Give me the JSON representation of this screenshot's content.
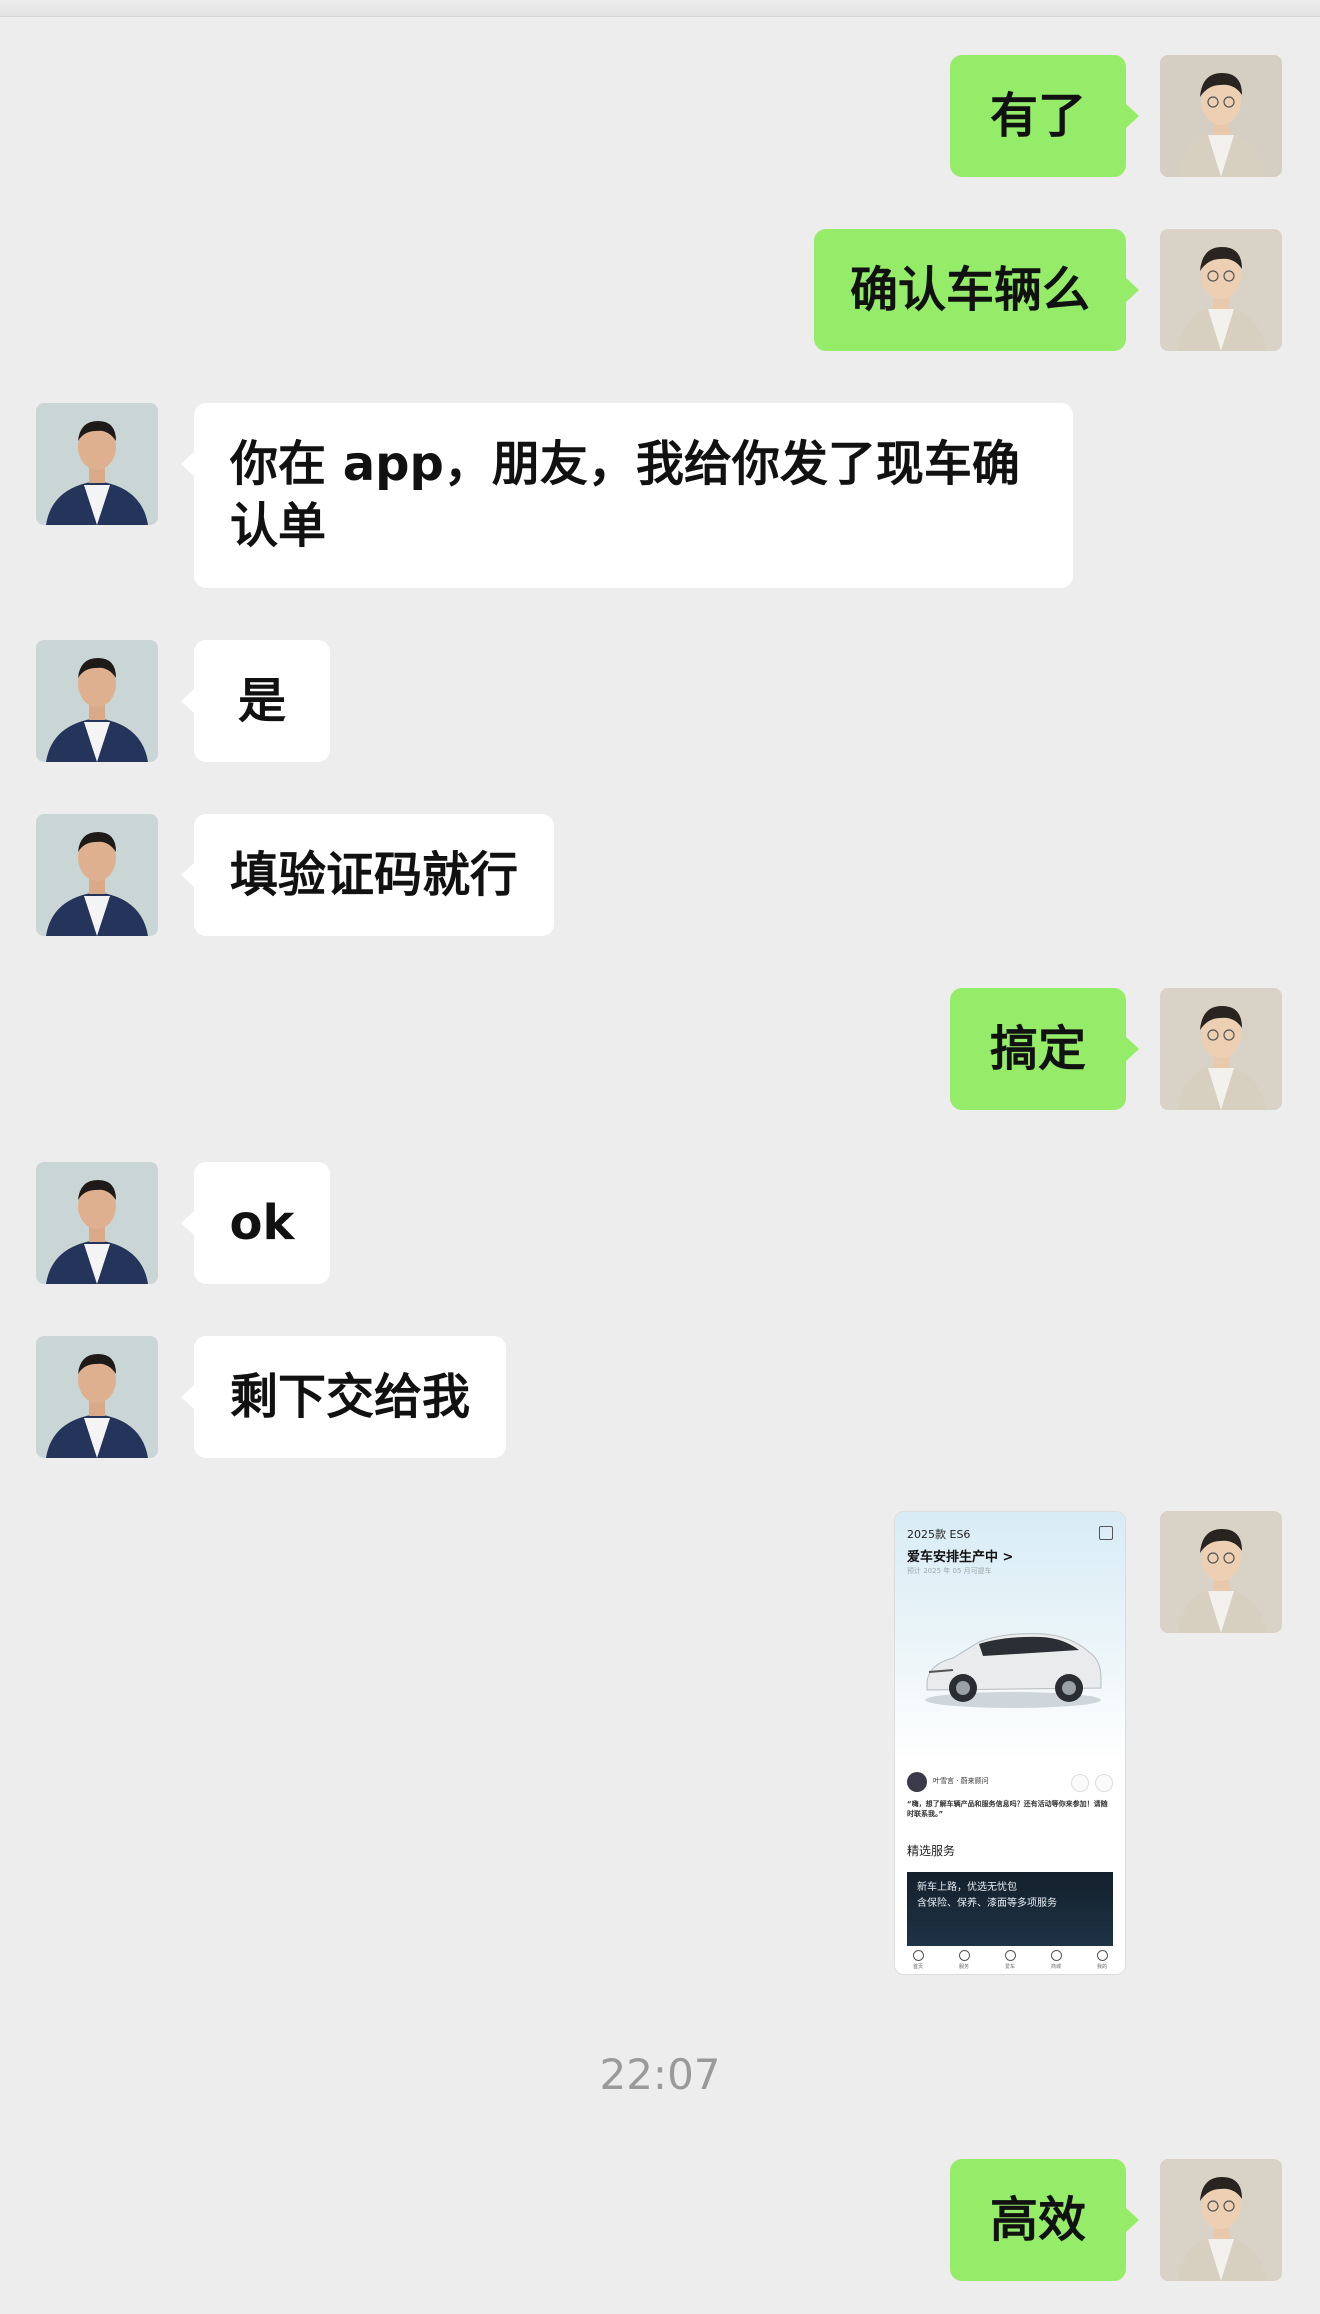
{
  "chat": {
    "messages": [
      {
        "sender": "me",
        "text": "有了"
      },
      {
        "sender": "me",
        "text": "确认车辆么"
      },
      {
        "sender": "other",
        "text": "你在 app，朋友，我给你发了现车确认单"
      },
      {
        "sender": "other",
        "text": "是"
      },
      {
        "sender": "other",
        "text": "填验证码就行"
      },
      {
        "sender": "me",
        "text": "搞定"
      },
      {
        "sender": "other",
        "text": "ok"
      },
      {
        "sender": "other",
        "text": "剩下交给我"
      },
      {
        "sender": "me",
        "type": "image",
        "description": "vehicle order status screenshot"
      },
      {
        "sender": "me",
        "text": "高效"
      }
    ],
    "timestamp": "22:07"
  },
  "shared_screenshot": {
    "model": "2025款 ES6",
    "status": "爱车安排生产中 >",
    "eta": "预计 2025 年 05 月可提车",
    "advisor_name": "叶雪言 · 蔚来顾问",
    "quote": "“嗨，想了解车辆产品和服务信息吗？还有活动等你来参加！请随时联系我。”",
    "section_title": "精选服务",
    "banner_line1": "新车上路，优选无忧包",
    "banner_line2": "含保险、保养、漆面等多项服务",
    "nav": [
      "首页",
      "服务",
      "爱车",
      "商城",
      "我的"
    ]
  },
  "colors": {
    "background": "#ededed",
    "my_bubble": "#95ec69",
    "other_bubble": "#ffffff",
    "timestamp": "#9a9a9a"
  }
}
